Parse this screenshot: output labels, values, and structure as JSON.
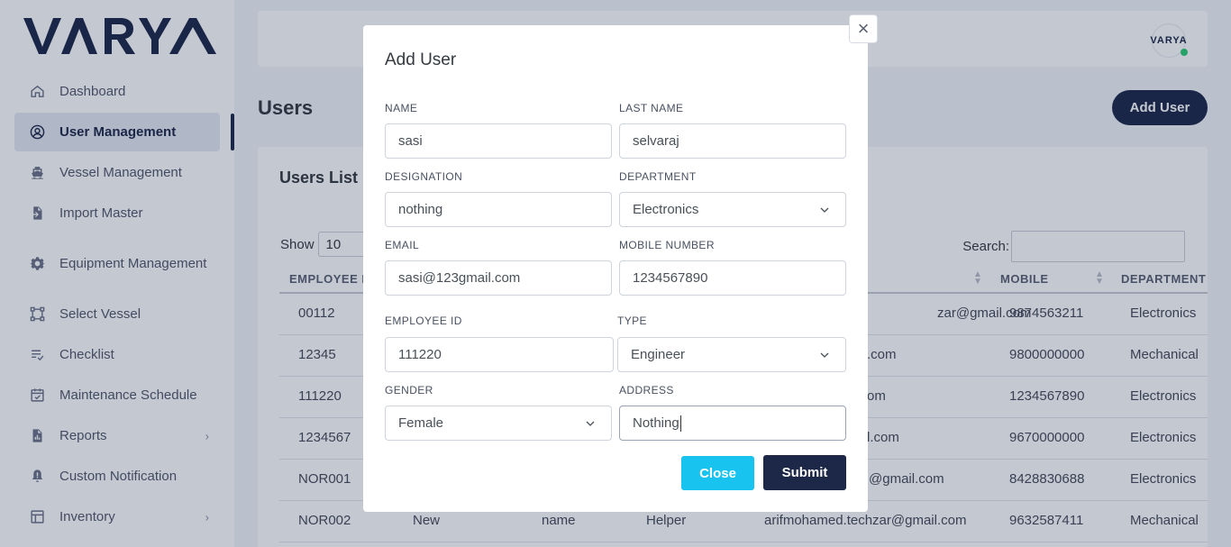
{
  "app": {
    "logo_text": "VARYA",
    "avatar_text": "VARYA"
  },
  "sidebar": {
    "items": [
      {
        "label": "Dashboard",
        "icon": "home-icon"
      },
      {
        "label": "User Management",
        "icon": "user-circle-icon",
        "active": true
      },
      {
        "label": "Vessel Management",
        "icon": "ship-icon"
      },
      {
        "label": "Import Master",
        "icon": "file-import-icon"
      },
      {
        "label": "Equipment Management",
        "icon": "gear-icon"
      },
      {
        "label": "Select Vessel",
        "icon": "vector-square-icon"
      },
      {
        "label": "Checklist",
        "icon": "list-check-icon"
      },
      {
        "label": "Maintenance Schedule",
        "icon": "calendar-check-icon"
      },
      {
        "label": "Reports",
        "icon": "file-chart-icon",
        "has_children": true
      },
      {
        "label": "Custom Notification",
        "icon": "bell-alert-icon"
      },
      {
        "label": "Inventory",
        "icon": "layout-icon",
        "has_children": true
      }
    ]
  },
  "main": {
    "page_title": "Users",
    "add_user_label": "Add User",
    "card_title": "Users List",
    "show_label": "Show",
    "show_value": "10",
    "search_label": "Search:",
    "columns": [
      "EMPLOYEE I",
      "MOBILE",
      "DEPARTMENT"
    ],
    "rows": [
      {
        "id": "00112",
        "first": "",
        "last": "",
        "desig": "",
        "email": "zar@gmail.com",
        "mobile": "9874563211",
        "dept": "Electronics"
      },
      {
        "id": "12345",
        "first": "",
        "last": "",
        "desig": "",
        "email": ".com",
        "mobile": "9800000000",
        "dept": "Mechanical"
      },
      {
        "id": "111220",
        "first": "",
        "last": "",
        "desig": "",
        "email": "om",
        "mobile": "1234567890",
        "dept": "Electronics"
      },
      {
        "id": "1234567",
        "first": "",
        "last": "",
        "desig": "",
        "email": "l.com",
        "mobile": "9670000000",
        "dept": "Electronics"
      },
      {
        "id": "NOR001",
        "first": "",
        "last": "",
        "desig": "",
        "email": "@gmail.com",
        "mobile": "8428830688",
        "dept": "Electronics"
      },
      {
        "id": "NOR002",
        "first": "New",
        "last": "name",
        "desig": "Helper",
        "email": "arifmohamed.techzar@gmail.com",
        "mobile": "9632587411",
        "dept": "Mechanical"
      }
    ]
  },
  "modal": {
    "title": "Add User",
    "close_icon": "×",
    "fields": {
      "name": {
        "label": "NAME",
        "value": "sasi"
      },
      "last_name": {
        "label": "LAST NAME",
        "value": "selvaraj"
      },
      "designation": {
        "label": "DESIGNATION",
        "value": "nothing"
      },
      "department": {
        "label": "DEPARTMENT",
        "value": "Electronics"
      },
      "email": {
        "label": "EMAIL",
        "value": "sasi@123gmail.com"
      },
      "mobile": {
        "label": "MOBILE NUMBER",
        "value": "1234567890"
      },
      "employee_id": {
        "label": "EMPLOYEE ID",
        "value": "111220"
      },
      "type": {
        "label": "TYPE",
        "value": "Engineer"
      },
      "gender": {
        "label": "GENDER",
        "value": "Female"
      },
      "address": {
        "label": "ADDRESS",
        "value": "Nothing"
      }
    },
    "close_label": "Close",
    "submit_label": "Submit"
  },
  "colors": {
    "primary": "#1d2747",
    "info": "#18c3ef",
    "status_online": "#2ecc71"
  }
}
